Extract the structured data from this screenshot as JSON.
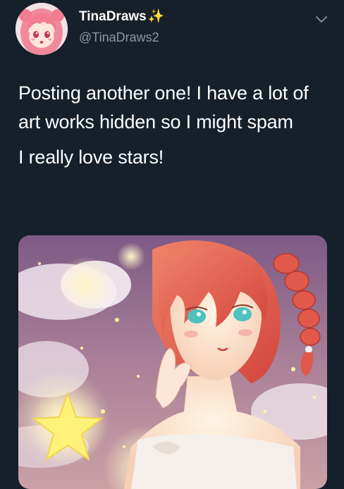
{
  "tweet": {
    "author": {
      "display_name": "TinaDraws",
      "name_emoji": "✨",
      "handle": "@TinaDraws2",
      "avatar_icon": "anime-girl-avatar"
    },
    "menu_icon": "chevron-down-icon",
    "text_lines": [
      "Posting another one! I have a lot of art works hidden so I might spam",
      "I really love stars!"
    ],
    "media": {
      "type": "illustration",
      "subject": "anime girl with red braided hair holding a star"
    }
  },
  "colors": {
    "background": "#15202b",
    "text_primary": "#ffffff",
    "text_secondary": "#8899a6",
    "sparkle": "#ffd447"
  }
}
